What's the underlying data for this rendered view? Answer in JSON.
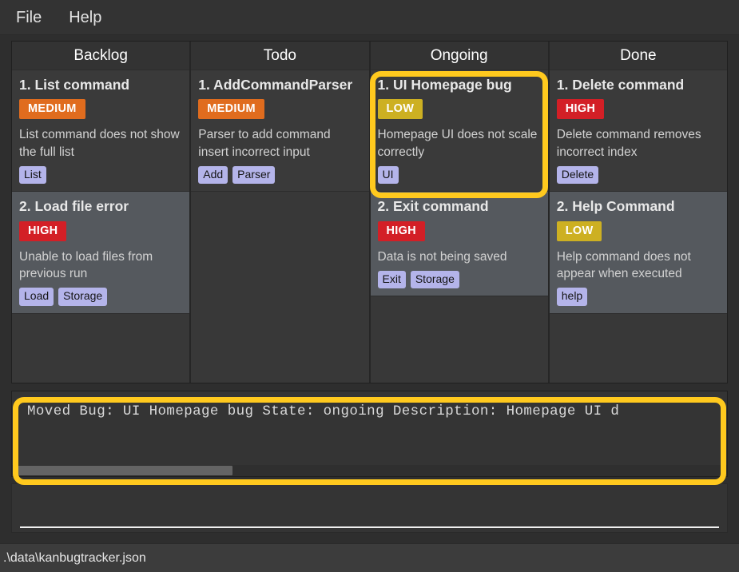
{
  "window": {
    "colors": {
      "background": "#2e2e2e",
      "panel": "#343434",
      "card_base": "#3a3a3a",
      "card_alt": "#55595e",
      "highlight": "#ffc91e",
      "priority_high": "#d31f26",
      "priority_medium": "#e06c1e",
      "priority_low": "#cdb022",
      "tag": "#b4b4ea"
    }
  },
  "menubar": {
    "items": [
      {
        "label": "File",
        "name": "menu-file"
      },
      {
        "label": "Help",
        "name": "menu-help"
      }
    ]
  },
  "board": {
    "columns": [
      {
        "title": "Backlog",
        "cards": [
          {
            "title": "1. List command",
            "priority": "MEDIUM",
            "description": "List command does not show the full list",
            "tags": [
              "List"
            ]
          },
          {
            "title": "2. Load file error",
            "priority": "HIGH",
            "description": "Unable to load files from previous run",
            "tags": [
              "Load",
              "Storage"
            ]
          }
        ]
      },
      {
        "title": "Todo",
        "cards": [
          {
            "title": "1. AddCommandParser",
            "priority": "MEDIUM",
            "description": "Parser to add command insert incorrect input",
            "tags": [
              "Add",
              "Parser"
            ]
          }
        ]
      },
      {
        "title": "Ongoing",
        "cards": [
          {
            "title": "1. UI Homepage bug",
            "priority": "LOW",
            "description": "Homepage UI does not scale correctly",
            "tags": [
              "UI"
            ]
          },
          {
            "title": "2. Exit command",
            "priority": "HIGH",
            "description": "Data is not being saved",
            "tags": [
              "Exit",
              "Storage"
            ]
          }
        ]
      },
      {
        "title": "Done",
        "cards": [
          {
            "title": "1. Delete command",
            "priority": "HIGH",
            "description": "Delete command removes incorrect index",
            "tags": [
              "Delete"
            ]
          },
          {
            "title": "2. Help Command",
            "priority": "LOW",
            "description": "Help command does not appear when executed",
            "tags": [
              "help"
            ]
          }
        ]
      }
    ]
  },
  "log": {
    "text": "Moved Bug: UI Homepage bug State: ongoing Description: Homepage UI d",
    "scroll_thumb_label": "horizontal-scrollbar"
  },
  "command": {
    "value": "",
    "placeholder": ""
  },
  "statusbar": {
    "path": ".\\data\\kanbugtracker.json"
  }
}
